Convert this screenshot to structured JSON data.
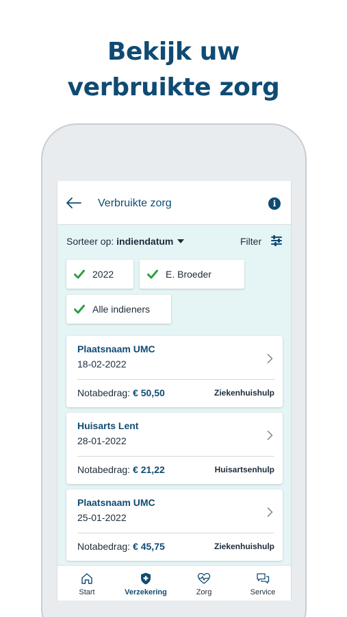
{
  "headline": {
    "line1": "Bekijk uw",
    "line2": "verbruikte zorg"
  },
  "appbar": {
    "title": "Verbruikte zorg",
    "info_icon": "i"
  },
  "toolbar": {
    "sort_prefix": "Sorteer op: ",
    "sort_value": "indiendatum",
    "filter_label": "Filter"
  },
  "chips": [
    {
      "label": "2022"
    },
    {
      "label": "E. Broeder"
    },
    {
      "label": "Alle indieners"
    }
  ],
  "claims": [
    {
      "title": "Plaatsnaam UMC",
      "date": "18-02-2022",
      "amount_label": "Notabedrag:",
      "amount": "€ 50,50",
      "category": "Ziekenhuishulp"
    },
    {
      "title": "Huisarts Lent",
      "date": "28-01-2022",
      "amount_label": "Notabedrag:",
      "amount": "€ 21,22",
      "category": "Huisartsenhulp"
    },
    {
      "title": "Plaatsnaam UMC",
      "date": "25-01-2022",
      "amount_label": "Notabedrag:",
      "amount": "€ 45,75",
      "category": "Ziekenhuishulp"
    }
  ],
  "bottom_nav": [
    {
      "label": "Start",
      "icon": "home-icon",
      "active": false
    },
    {
      "label": "Verzekering",
      "icon": "shield-plus-icon",
      "active": true
    },
    {
      "label": "Zorg",
      "icon": "heart-pulse-icon",
      "active": false
    },
    {
      "label": "Service",
      "icon": "chat-bubbles-icon",
      "active": false
    }
  ],
  "colors": {
    "brand": "#0f4b73",
    "check": "#2e9e3e",
    "screen_bg": "#e5f4f5"
  }
}
